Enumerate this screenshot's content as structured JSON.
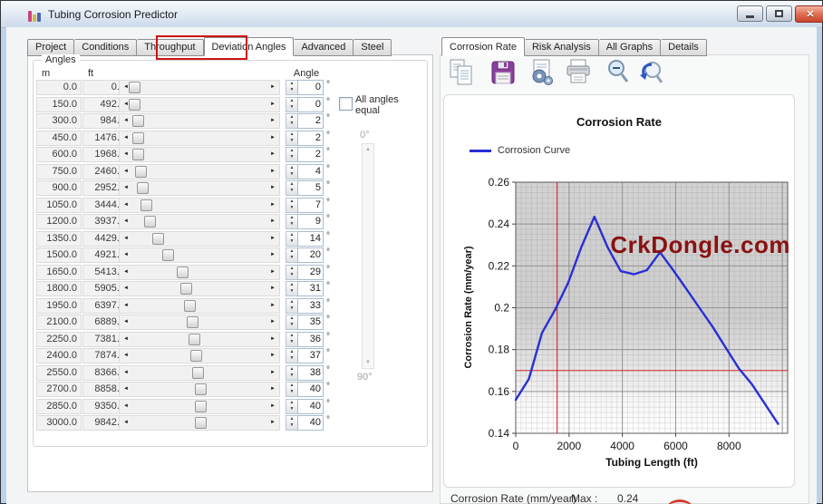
{
  "window": {
    "title": "Tubing Corrosion Predictor"
  },
  "left_tabs": {
    "items": [
      "Project",
      "Conditions",
      "Throughput",
      "Deviation Angles",
      "Advanced",
      "Steel"
    ],
    "active": "Deviation Angles",
    "highlight_color": "#cf1414"
  },
  "right_tabs": {
    "items": [
      "Corrosion Rate",
      "Risk Analysis",
      "All Graphs",
      "Details"
    ],
    "active": "Corrosion Rate"
  },
  "toolbar": {
    "icons": [
      "copy",
      "save",
      "export",
      "print",
      "zoom-out",
      "zoom-reset"
    ]
  },
  "angles_group": {
    "title": "Angles",
    "columns": {
      "m": "m",
      "ft": "ft",
      "angle": "Angle"
    },
    "degree_symbol": "°",
    "all_angles_equal_label": "All angles equal",
    "all_angles_equal_checked": false,
    "angle_scale": {
      "top": "0°",
      "bottom": "90°"
    },
    "slider_range": [
      0,
      90
    ],
    "rows": [
      {
        "m": "0.0",
        "ft": "0.0",
        "angle": 0
      },
      {
        "m": "150.0",
        "ft": "492.1",
        "angle": 0
      },
      {
        "m": "300.0",
        "ft": "984.3",
        "angle": 2
      },
      {
        "m": "450.0",
        "ft": "1476.4",
        "angle": 2
      },
      {
        "m": "600.0",
        "ft": "1968.5",
        "angle": 2
      },
      {
        "m": "750.0",
        "ft": "2460.6",
        "angle": 4
      },
      {
        "m": "900.0",
        "ft": "2952.8",
        "angle": 5
      },
      {
        "m": "1050.0",
        "ft": "3444.9",
        "angle": 7
      },
      {
        "m": "1200.0",
        "ft": "3937.0",
        "angle": 9
      },
      {
        "m": "1350.0",
        "ft": "4429.1",
        "angle": 14
      },
      {
        "m": "1500.0",
        "ft": "4921.3",
        "angle": 20
      },
      {
        "m": "1650.0",
        "ft": "5413.4",
        "angle": 29
      },
      {
        "m": "1800.0",
        "ft": "5905.5",
        "angle": 31
      },
      {
        "m": "1950.0",
        "ft": "6397.6",
        "angle": 33
      },
      {
        "m": "2100.0",
        "ft": "6889.8",
        "angle": 35
      },
      {
        "m": "2250.0",
        "ft": "7381.9",
        "angle": 36
      },
      {
        "m": "2400.0",
        "ft": "7874.0",
        "angle": 37
      },
      {
        "m": "2550.0",
        "ft": "8366.1",
        "angle": 38
      },
      {
        "m": "2700.0",
        "ft": "8858.3",
        "angle": 40
      },
      {
        "m": "2850.0",
        "ft": "9350.4",
        "angle": 40
      },
      {
        "m": "3000.0",
        "ft": "9842.5",
        "angle": 40
      }
    ]
  },
  "chart_data": {
    "type": "line",
    "title": "Corrosion Rate",
    "xlabel": "Tubing Length (ft)",
    "ylabel": "Corrosion Rate (mm/year)",
    "xlim": [
      0,
      10200
    ],
    "ylim": [
      0.14,
      0.26
    ],
    "xticks": [
      0,
      2000,
      4000,
      6000,
      8000
    ],
    "yticks": [
      0.14,
      0.16,
      0.18,
      0.2,
      0.22,
      0.24,
      0.26
    ],
    "ytick_labels": [
      "0.14",
      "0.16",
      "0.18",
      "0.2",
      "0.22",
      "0.24",
      "0.26"
    ],
    "minor_grid": {
      "x_step": 200,
      "y_step": 0.0025
    },
    "grid": true,
    "legend_position": "top-left",
    "legend": [
      {
        "label": "Corrosion Curve",
        "color": "#2a2fd4"
      }
    ],
    "series": [
      {
        "name": "Corrosion Curve",
        "color": "#2a2fd4",
        "x": [
          0,
          492.1,
          984.3,
          1476.4,
          1968.5,
          2460.6,
          2952.8,
          3444.9,
          3937.0,
          4429.1,
          4921.3,
          5413.4,
          5905.5,
          6397.6,
          6889.8,
          7381.9,
          7874.0,
          8366.1,
          8858.3,
          9350.4,
          9842.5
        ],
        "y": [
          0.156,
          0.166,
          0.188,
          0.199,
          0.212,
          0.229,
          0.2435,
          0.229,
          0.2175,
          0.216,
          0.218,
          0.2265,
          0.218,
          0.209,
          0.2,
          0.191,
          0.181,
          0.171,
          0.1635,
          0.154,
          0.1445
        ]
      }
    ],
    "reference_lines": {
      "vertical_x": 1550,
      "horizontal_y": 0.17,
      "color": "#cc2020"
    }
  },
  "watermark": {
    "text": "CrkDongle.com",
    "color": "#8a1111"
  },
  "status_bar": {
    "label": "Corrosion Rate (mm/year)",
    "max_label": "Max :",
    "max_value": "0.24"
  }
}
